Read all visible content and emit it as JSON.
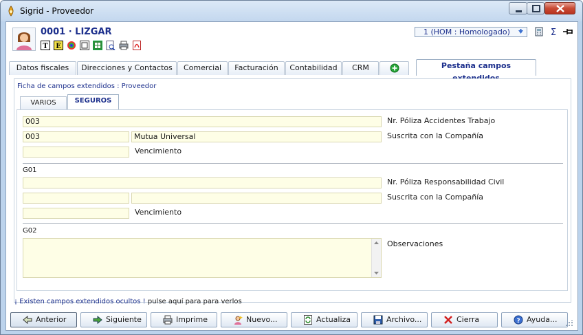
{
  "window": {
    "title": "Sigrid - Proveedor"
  },
  "header": {
    "provider_title": "0001 · LIZGAR",
    "status_value": "1 (HOM : Homologado)",
    "toolbar_icons": [
      "text-format-icon",
      "text-edit-icon",
      "color-palette-icon",
      "document-view-icon",
      "spreadsheet-icon",
      "preview-icon",
      "print-icon",
      "pdf-icon"
    ],
    "right_icons": [
      "calculator-icon",
      "sum-icon",
      "pin-icon"
    ]
  },
  "tabs": [
    {
      "label": "Datos fiscales"
    },
    {
      "label": "Direcciones y Contactos"
    },
    {
      "label": "Comercial"
    },
    {
      "label": "Facturación"
    },
    {
      "label": "Contabilidad"
    },
    {
      "label": "CRM"
    },
    {
      "label": ""
    },
    {
      "label": "Pestaña campos extendidos"
    }
  ],
  "active_tab": "Pestaña campos extendidos",
  "panel": {
    "caption": "Ficha de campos extendidos : Proveedor",
    "subtabs": [
      {
        "label": "VARIOS"
      },
      {
        "label": "SEGUROS"
      }
    ],
    "active_subtab": "SEGUROS"
  },
  "form": {
    "sec1": {
      "poliza_value": "003",
      "poliza_label": "Nr. Póliza Accidentes Trabajo",
      "compania_code": "003",
      "compania_name": "Mutua Universal",
      "compania_label": "Suscrita con la Compañía",
      "vencimiento_value": "",
      "vencimiento_label": "Vencimiento"
    },
    "g01": {
      "group_label": "G01",
      "poliza_value": "",
      "poliza_label": "Nr. Póliza Responsabilidad Civil",
      "compania_code": "",
      "compania_name": "",
      "compania_label": "Suscrita con la Compañía",
      "vencimiento_value": "",
      "vencimiento_label": "Vencimiento"
    },
    "g02": {
      "group_label": "G02",
      "observaciones_value": "",
      "observaciones_label": "Observaciones"
    }
  },
  "hint": {
    "text": "¡ Existen campos extendidos ocultos !",
    "link": "pulse aquí para para verlos"
  },
  "buttons": [
    {
      "label": "Anterior",
      "icon": "arrow-left-icon"
    },
    {
      "label": "Siguiente",
      "icon": "arrow-right-icon"
    },
    {
      "label": "Imprime",
      "icon": "printer-icon"
    },
    {
      "label": "Nuevo...",
      "icon": "new-user-icon"
    },
    {
      "label": "Actualiza",
      "icon": "refresh-icon"
    },
    {
      "label": "Archivo...",
      "icon": "save-icon"
    },
    {
      "label": "Cierra",
      "icon": "close-x-icon"
    },
    {
      "label": "Ayuda...",
      "icon": "help-icon"
    }
  ],
  "colors": {
    "accent_text": "#1c2f8c",
    "field_bg": "#fefee6",
    "window_frame": "#bcd3ec",
    "close_button": "#c94b35"
  }
}
